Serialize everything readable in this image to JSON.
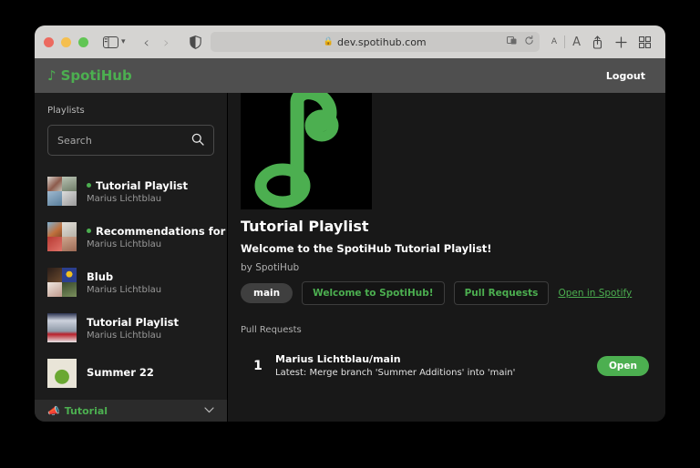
{
  "browser": {
    "url": "dev.spotihub.com",
    "lock_icon": "lock-icon",
    "sidebar_icon": "sidebar-toggle-icon",
    "back_icon": "back-arrow-icon",
    "forward_icon": "forward-arrow-icon",
    "shield_icon": "privacy-shield-icon",
    "reader_icon": "reader-mode-icon",
    "reload_icon": "reload-icon",
    "font_small": "A",
    "font_big": "A",
    "share_icon": "share-icon",
    "newtab_icon": "new-tab-icon",
    "tabs_icon": "tab-overview-icon"
  },
  "header": {
    "brand": "SpotiHub",
    "brand_note_glyph": "♪",
    "logout_label": "Logout"
  },
  "sidebar": {
    "title": "Playlists",
    "search": {
      "placeholder": "Search",
      "value": "",
      "icon": "search-icon"
    },
    "playlists": [
      {
        "name": "Tutorial Playlist",
        "owner": "Marius Lichtblau",
        "has_dot": true
      },
      {
        "name": "Recommendations for you",
        "owner": "Marius Lichtblau",
        "has_dot": true
      },
      {
        "name": "Blub",
        "owner": "Marius Lichtblau",
        "has_dot": false
      },
      {
        "name": "Tutorial Playlist",
        "owner": "Marius Lichtblau",
        "has_dot": false
      },
      {
        "name": "Summer 22",
        "owner": "",
        "has_dot": false
      }
    ],
    "footer": {
      "emoji": "📣",
      "label": "Tutorial",
      "chevron": "⌄"
    }
  },
  "main": {
    "cover_icon": "music-note-logo",
    "title": "Tutorial Playlist",
    "description": "Welcome to the SpotiHub Tutorial Playlist!",
    "byline": "by SpotiHub",
    "branch_pill": "main",
    "buttons": [
      {
        "label": "Welcome to SpotiHub!"
      },
      {
        "label": "Pull Requests"
      }
    ],
    "spotify_link": "Open in Spotify",
    "pull_requests_label": "Pull Requests",
    "pull_requests": [
      {
        "number": "1",
        "title": "Marius Lichtblau/main",
        "subtitle": "Latest: Merge branch 'Summer Additions' into 'main'",
        "status": "Open"
      }
    ]
  },
  "colors": {
    "accent_green": "#4caf50",
    "page_bg": "#181818",
    "header_bg": "#4f4f4f",
    "sidebar_bg": "#1c1c1c"
  }
}
